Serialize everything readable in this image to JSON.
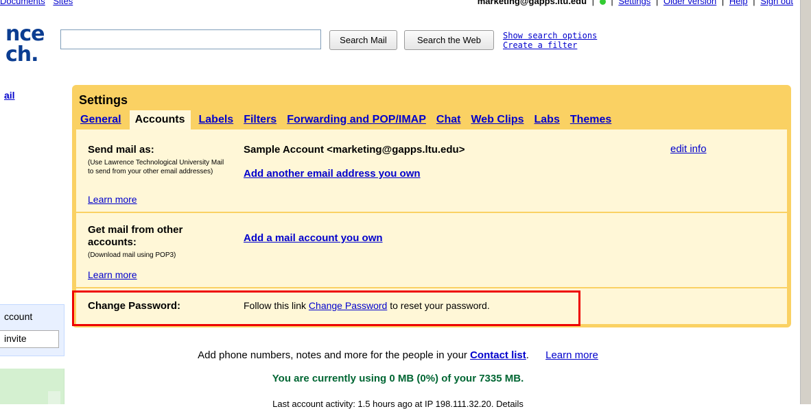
{
  "topbar": {
    "left_links": [
      "Documents",
      "Sites"
    ],
    "email": "marketing@gapps.ltu.edu",
    "right_links": [
      "Settings",
      "Older version",
      "Help",
      "Sign out"
    ]
  },
  "logo": {
    "line1": "nce",
    "line2": "ch."
  },
  "search": {
    "input_value": "",
    "mail_button": "Search Mail",
    "web_button": "Search the Web",
    "options_link": "Show search options",
    "filter_link": "Create a filter"
  },
  "leftnav": {
    "mail_link": "ail",
    "account_label": "ccount",
    "invite_value": "invite"
  },
  "settings": {
    "title": "Settings",
    "tabs": [
      {
        "label": "General"
      },
      {
        "label": "Accounts"
      },
      {
        "label": "Labels"
      },
      {
        "label": "Filters"
      },
      {
        "label": "Forwarding and POP/IMAP"
      },
      {
        "label": "Chat"
      },
      {
        "label": "Web Clips"
      },
      {
        "label": "Labs"
      },
      {
        "label": "Themes"
      }
    ],
    "send_mail": {
      "label": "Send mail as:",
      "note": "(Use Lawrence Technological University Mail to send from your other email addresses)",
      "learn_more": "Learn more",
      "account": "Sample Account <marketing@gapps.ltu.edu>",
      "add_link": "Add another email address you own",
      "edit_link": "edit info"
    },
    "get_mail": {
      "label": "Get mail from other accounts:",
      "note": "(Download mail using POP3)",
      "learn_more": "Learn more",
      "add_link": "Add a mail account you own"
    },
    "change_password": {
      "label": "Change Password:",
      "text_before": "Follow this link",
      "link": "Change Password",
      "text_after": "to reset your password."
    }
  },
  "footer": {
    "contacts_text": "Add phone numbers, notes and more for the people in your",
    "contacts_link": "Contact list",
    "contacts_period": ".",
    "learn_more": "Learn more",
    "usage": "You are currently using 0 MB (0%) of your 7335 MB.",
    "activity": "Last account activity: 1.5 hours ago at IP 198.111.32.20. Details"
  },
  "colors": {
    "panel": "#fad163",
    "panel_body": "#fff7d7",
    "link": "#0000cc",
    "highlight": "#e00000",
    "usage_text": "#006633"
  }
}
